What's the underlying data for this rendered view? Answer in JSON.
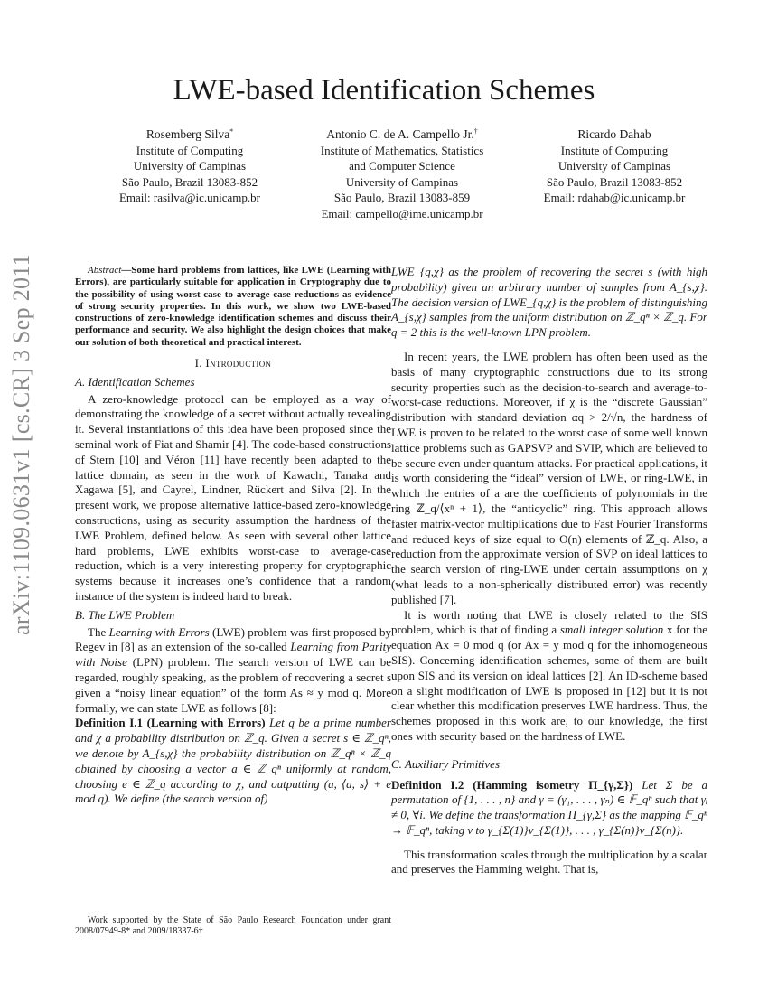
{
  "stamp": "arXiv:1109.0631v1  [cs.CR]  3 Sep 2011",
  "title": "LWE-based Identification Schemes",
  "authors": [
    {
      "name": "Rosemberg Silva",
      "mark": "*",
      "lines": [
        "Institute of Computing",
        "University of Campinas",
        "São Paulo, Brazil 13083-852",
        "Email: rasilva@ic.unicamp.br"
      ]
    },
    {
      "name": "Antonio C. de A. Campello Jr.",
      "mark": "†",
      "lines": [
        "Institute of Mathematics, Statistics",
        "and Computer Science",
        "University of Campinas",
        "São Paulo, Brazil 13083-859",
        "Email: campello@ime.unicamp.br"
      ]
    },
    {
      "name": "Ricardo Dahab",
      "mark": "",
      "lines": [
        "Institute of Computing",
        "University of Campinas",
        "São Paulo, Brazil 13083-852",
        "Email: rdahab@ic.unicamp.br"
      ]
    }
  ],
  "abstract": {
    "label": "Abstract",
    "text": "—Some hard problems from lattices, like LWE (Learning with Errors), are particularly suitable for application in Cryptography due to the possibility of using worst-case to average-case reductions as evidence of strong security properties. In this work, we show two LWE-based constructions of zero-knowledge identification schemes and discuss their performance and security. We also highlight the design choices that make our solution of both theoretical and practical interest."
  },
  "section1": {
    "number": "I.",
    "title": "Introduction"
  },
  "subA": {
    "label": "A.",
    "title": "Identification Schemes",
    "para": "A zero-knowledge protocol can be employed as a way of demonstrating the knowledge of a secret without actually revealing it. Several instantiations of this idea have been proposed since the seminal work of Fiat and Shamir [4]. The code-based constructions of Stern [10] and Véron [11] have recently been adapted to the lattice domain, as seen in the work of Kawachi, Tanaka and Xagawa [5], and Cayrel, Lindner, Rückert and Silva [2]. In the present work, we propose alternative lattice-based zero-knowledge constructions, using as security assumption the hardness of the LWE Problem, defined below. As seen with several other lattice hard problems, LWE exhibits worst-case to average-case reduction, which is a very interesting property for cryptographic systems because it increases one’s confidence that a random instance of the system is indeed hard to break."
  },
  "subB": {
    "label": "B.",
    "title": "The LWE Problem",
    "p1": "The ",
    "p1_it": "Learning with Errors",
    "p2": " (LWE) problem was first proposed by Regev in [8] as an extension of the so-called ",
    "p2_it": "Learning from Parity with Noise",
    "p3": " (LPN) problem. The search version of LWE can be regarded, roughly speaking, as the problem of recovering a secret s given a “noisy linear equation” of the form As ≈ y mod q. More formally, we can state LWE as follows [8]:"
  },
  "def1": {
    "head": "Definition I.1 (Learning with Errors)",
    "text_left": " Let q be a prime number and χ a probability distribution on ℤ_q. Given a secret s ∈ ℤ_qⁿ, we denote by A_{s,χ} the probability distribution on ℤ_qⁿ × ℤ_q obtained by choosing a vector a ∈ ℤ_qⁿ uniformly at random, choosing e ∈ ℤ_q according to χ, and outputting (a, ⟨a, s⟩ + e  mod q). We define (the search version of)",
    "text_right": "LWE_{q,χ} as the problem of recovering the secret s (with high probability) given an arbitrary number of samples from A_{s,χ}. The decision version of LWE_{q,χ} is the problem of distinguishing A_{s,χ} samples from the uniform distribution on ℤ_qⁿ × ℤ_q. For q = 2 this is the well-known LPN problem."
  },
  "right_p1": "In recent years, the LWE problem has often been used as the basis of many cryptographic constructions due to its strong security properties such as the decision-to-search and average-to-worst-case reductions. Moreover, if χ is the “discrete Gaussian” distribution with standard deviation αq > 2/√n, the hardness of LWE is proven to be related to the worst case of some well known lattice problems such as GAPSVP and SVIP, which are believed to be secure even under quantum attacks. For practical applications, it is worth considering the “ideal” version of LWE, or ring-LWE, in which the entries of a are the coefficients of polynomials in the ring ℤ_q/⟨xⁿ + 1⟩, the “anticyclic” ring. This approach allows faster matrix-vector multiplications due to Fast Fourier Transforms and reduced keys of size equal to O(n) elements of ℤ_q. Also, a reduction from the approximate version of SVP on ideal lattices to the search version of ring-LWE under certain assumptions on χ (what leads to a non-spherically distributed error) was recently published [7].",
  "right_p2a": "It is worth noting that LWE is closely related to the SIS problem, which is that of finding a ",
  "right_p2_it": "small integer solution",
  "right_p2b": " x for the equation Ax = 0 mod q (or Ax = y mod q for the inhomogeneous SIS). Concerning identification schemes, some of them are built upon SIS and its version on ideal lattices [2]. An ID-scheme based on a slight modification of LWE is proposed in [12] but it is not clear whether this modification preserves LWE hardness. Thus, the schemes proposed in this work are, to our knowledge, the first ones with security based on the hardness of LWE.",
  "subC": {
    "label": "C.",
    "title": "Auxiliary Primitives"
  },
  "def2": {
    "head": "Definition I.2 (Hamming isometry Π_{γ,Σ})",
    "text": " Let Σ be a permutation of {1, . . . , n} and γ = (γ₁, . . . , γₙ) ∈ 𝔽_qⁿ such that γᵢ ≠ 0, ∀i. We define the transformation Π_{γ,Σ} as the mapping 𝔽_qⁿ → 𝔽_qⁿ, taking v to γ_{Σ(1)}v_{Σ(1)}, . . . , γ_{Σ(n)}v_{Σ(n)}."
  },
  "right_p3": "This transformation scales through the multiplication by a scalar and preserves the Hamming weight. That is,",
  "footnote": "Work supported by the State of São Paulo Research Foundation under grant 2008/07949-8* and 2009/18337-6†"
}
